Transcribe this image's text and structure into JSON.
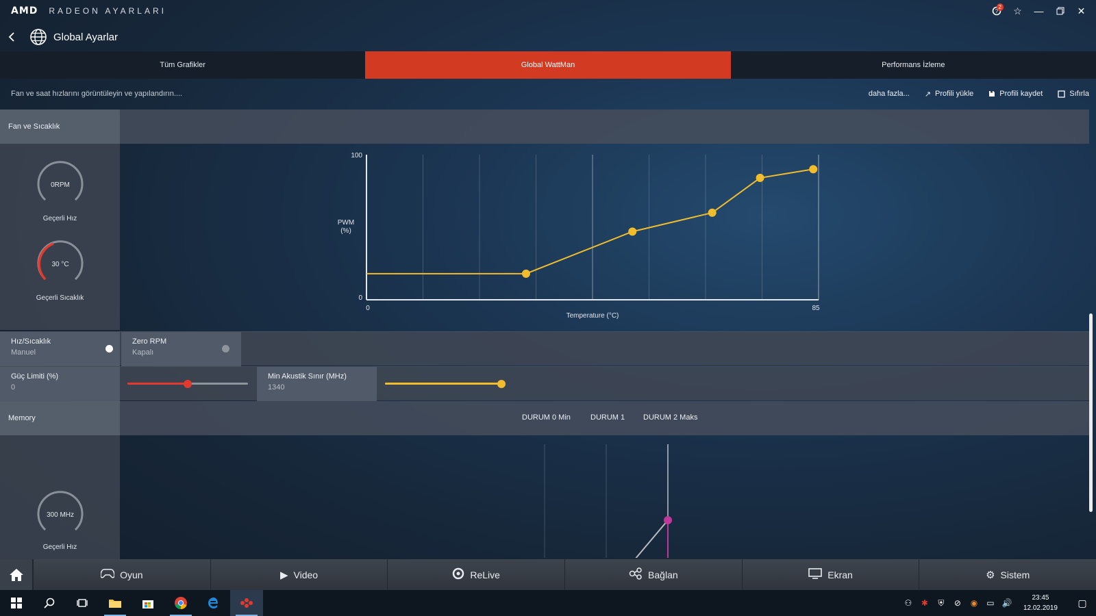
{
  "app": {
    "brand": "AMD",
    "name": "RADEON AYARLARI",
    "notification_count": "2"
  },
  "header": {
    "title": "Global Ayarlar"
  },
  "tabs": [
    {
      "label": "Tüm Grafikler",
      "active": false
    },
    {
      "label": "Global WattMan",
      "active": true
    },
    {
      "label": "Performans İzleme",
      "active": false
    }
  ],
  "subheader": {
    "hint": "Fan ve saat hızlarını görüntüleyin ve yapılandırın....",
    "more": "daha fazla...",
    "load_profile": "Profili yükle",
    "save_profile": "Profili kaydet",
    "reset": "Sıfırla"
  },
  "fan_section": {
    "label": "Fan ve Sıcaklık",
    "speed_gauge": {
      "value": "0RPM",
      "label": "Geçerli Hız"
    },
    "temp_gauge": {
      "value": "30 °C",
      "label": "Geçerli Sıcaklık"
    }
  },
  "chart_data": {
    "type": "line",
    "xlabel": "Temperature (°C)",
    "ylabel": "PWM\n(%)",
    "xlim": [
      0,
      85
    ],
    "ylim": [
      0,
      100
    ],
    "x_tick_labels": [
      "0",
      "85"
    ],
    "y_tick_labels": [
      "0",
      "100"
    ],
    "x": [
      0,
      30,
      50,
      65,
      74,
      84
    ],
    "y": [
      18,
      18,
      47,
      60,
      84,
      90
    ],
    "color": "#f2bd2c",
    "grid": true
  },
  "controls": {
    "speed_temp": {
      "label": "Hız/Sıcaklık",
      "value": "Manuel"
    },
    "zero_rpm": {
      "label": "Zero RPM",
      "value": "Kapalı"
    },
    "power_limit": {
      "label": "Güç Limiti (%)",
      "value": "0",
      "slider_level": 0.5
    },
    "min_acoustic": {
      "label": "Min Akustik Sınır (MHz)",
      "value": "1340",
      "slider_level": 1.0
    }
  },
  "memory": {
    "label": "Memory",
    "states": [
      "DURUM 0 Min",
      "DURUM 1",
      "DURUM 2 Maks"
    ],
    "gauge": {
      "value": "300 MHz",
      "label": "Geçerli Hız"
    }
  },
  "bottom_nav": [
    {
      "label": "Oyun",
      "icon": "gamepad-icon"
    },
    {
      "label": "Video",
      "icon": "play-icon"
    },
    {
      "label": "ReLive",
      "icon": "relive-icon"
    },
    {
      "label": "Bağlan",
      "icon": "connect-icon"
    },
    {
      "label": "Ekran",
      "icon": "monitor-icon"
    },
    {
      "label": "Sistem",
      "icon": "system-icon"
    }
  ],
  "taskbar": {
    "time": "23:45",
    "date": "12.02.2019"
  },
  "colors": {
    "accent": "#d23a22",
    "curve": "#f2bd2c",
    "temp_arc": "#e23a2e",
    "memory_point": "#c0399a"
  }
}
